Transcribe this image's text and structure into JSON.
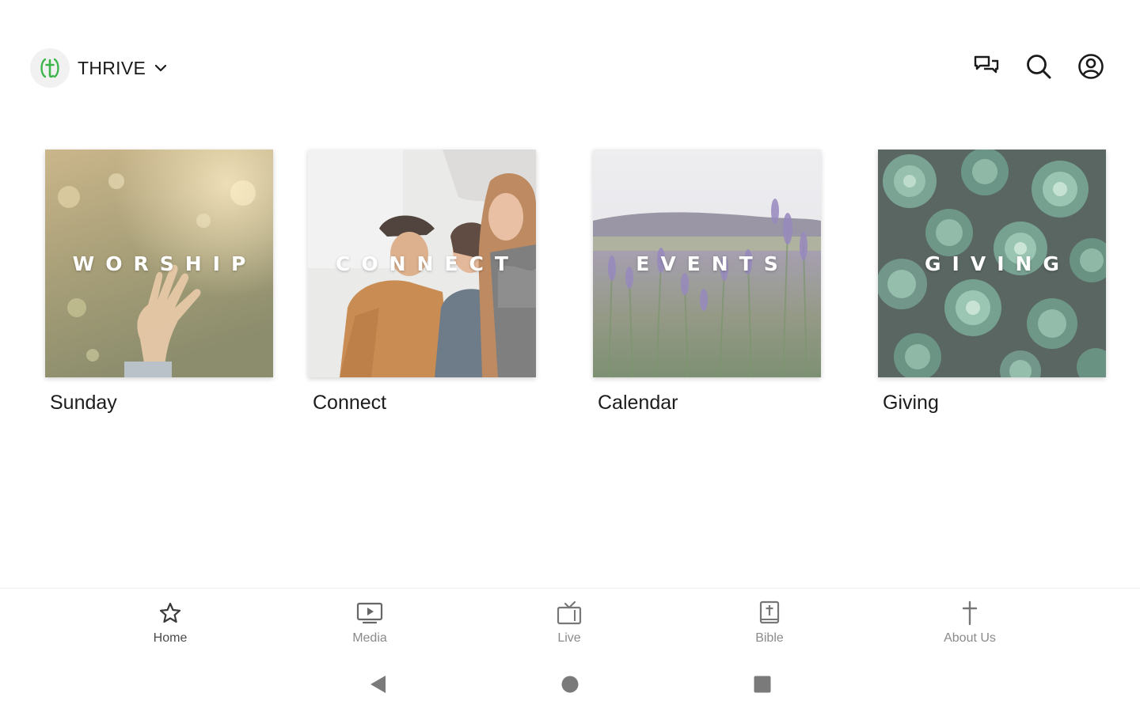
{
  "header": {
    "brand_name": "THRIVE",
    "logo_icon": "thrive-logo-icon",
    "actions": [
      "messages-icon",
      "search-icon",
      "account-icon"
    ]
  },
  "tiles": [
    {
      "overlay": "WORSHIP",
      "label": "Sunday"
    },
    {
      "overlay": "CONNECT",
      "label": "Connect"
    },
    {
      "overlay": "EVENTS",
      "label": "Calendar"
    },
    {
      "overlay": "GIVING",
      "label": "Giving"
    }
  ],
  "bottom_nav": [
    {
      "label": "Home",
      "icon": "star-icon"
    },
    {
      "label": "Media",
      "icon": "media-icon"
    },
    {
      "label": "Live",
      "icon": "tv-icon"
    },
    {
      "label": "Bible",
      "icon": "bible-icon"
    },
    {
      "label": "About Us",
      "icon": "cross-icon"
    }
  ],
  "system_nav": [
    "back-icon",
    "home-circle-icon",
    "recents-icon"
  ],
  "colors": {
    "brand_green": "#3bb54a",
    "nav_label": "#8a8a8a",
    "text": "#1a1a1a"
  }
}
